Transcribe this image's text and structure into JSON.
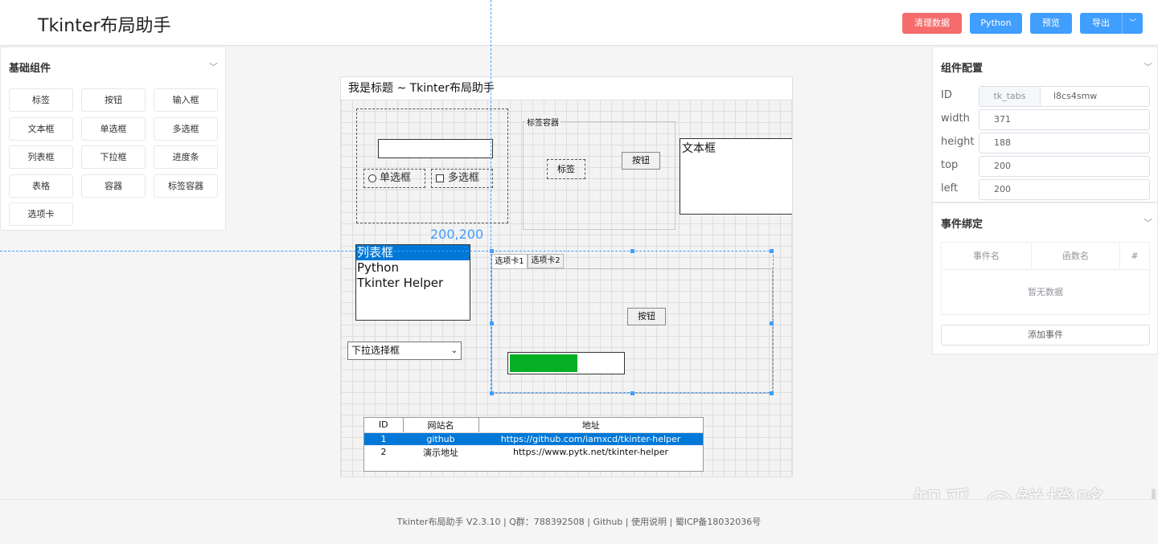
{
  "header": {
    "title": "Tkinter布局助手",
    "clear_label": "清理数据",
    "python_label": "Python",
    "preview_label": "预览",
    "export_label": "导出",
    "export_arrow": "﹀"
  },
  "left_panel": {
    "title": "基础组件",
    "chevron": "﹀",
    "items": [
      "标签",
      "按钮",
      "输入框",
      "文本框",
      "单选框",
      "多选框",
      "列表框",
      "下拉框",
      "进度条",
      "表格",
      "容器",
      "标签容器",
      "选项卡"
    ]
  },
  "canvas": {
    "window_title": "我是标题 ~ Tkinter布局助手",
    "coord_label": "200,200",
    "radio_label": "单选框",
    "checkbox_label": "多选框",
    "labelframe_title": "标签容器",
    "labelframe_label": "标签",
    "labelframe_button": "按钮",
    "text_widget": "文本框",
    "listbox_items": [
      "列表框",
      "Python",
      "Tkinter Helper"
    ],
    "tabs": [
      "选项卡1",
      "选项卡2"
    ],
    "tab_button": "按钮",
    "progress_value": 0.6,
    "combobox_value": "下拉选择框",
    "table": {
      "headers": [
        "ID",
        "网站名",
        "地址"
      ],
      "rows": [
        [
          "1",
          "github",
          "https://github.com/iamxcd/tkinter-helper"
        ],
        [
          "2",
          "演示地址",
          "https://www.pytk.net/tkinter-helper"
        ]
      ]
    }
  },
  "config": {
    "title": "组件配置",
    "chevron": "﹀",
    "id_label": "ID",
    "id_prefix": "tk_tabs",
    "id_value": "l8cs4smw",
    "width_label": "width",
    "width_value": "371",
    "height_label": "height",
    "height_value": "188",
    "top_label": "top",
    "top_value": "200",
    "left_label": "left",
    "left_value": "200"
  },
  "events": {
    "title": "事件绑定",
    "chevron": "﹀",
    "col_event": "事件名",
    "col_func": "函数名",
    "col_hash": "#",
    "empty": "暂无数据",
    "add_label": "添加事件"
  },
  "footer": {
    "text": "Tkinter布局助手 V2.3.10 | Q群：788392508 | Github | 使用说明 | 蜀ICP备18032036号"
  },
  "watermark": "知乎 @鲜橙哆",
  "colors": {
    "primary": "#409eff",
    "danger": "#f56c6c",
    "selection": "#0078d7",
    "progress": "#06b025"
  }
}
